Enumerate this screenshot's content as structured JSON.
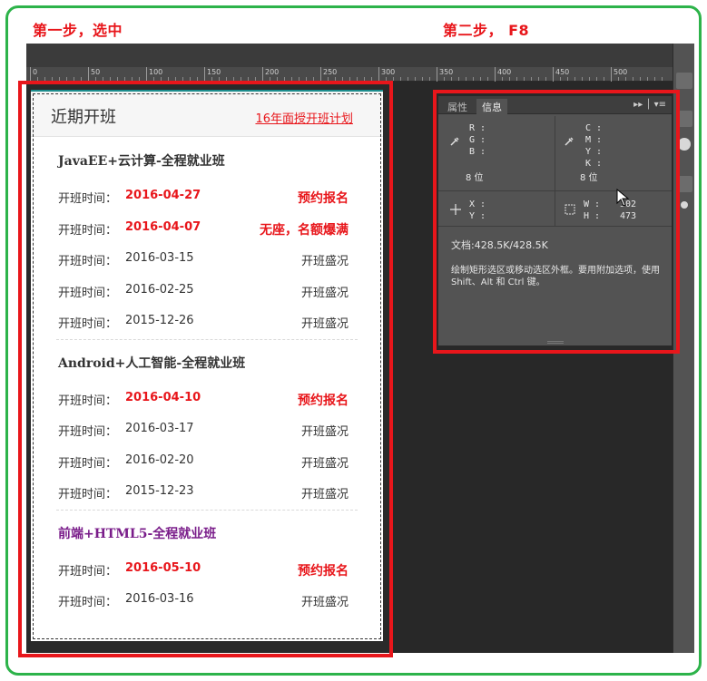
{
  "annotations": {
    "step1": "第一步，选中",
    "step2": "第二步， F8"
  },
  "ruler": {
    "labels": [
      "0",
      "50",
      "100",
      "150",
      "200",
      "250",
      "300",
      "350",
      "400",
      "450",
      "500"
    ]
  },
  "schedule": {
    "title": "近期开班",
    "plan_link": "16年面授开班计划",
    "courses": [
      {
        "name": "JavaEE+云计算-全程就业班",
        "color": "#333333",
        "rows": [
          {
            "label": "开班时间：",
            "date": "2016-04-27",
            "status": "预约报名",
            "highlight": true
          },
          {
            "label": "开班时间：",
            "date": "2016-04-07",
            "status": "无座，名额爆满",
            "highlight": true
          },
          {
            "label": "开班时间：",
            "date": "2016-03-15",
            "status": "开班盛况",
            "highlight": false
          },
          {
            "label": "开班时间：",
            "date": "2016-02-25",
            "status": "开班盛况",
            "highlight": false
          },
          {
            "label": "开班时间：",
            "date": "2015-12-26",
            "status": "开班盛况",
            "highlight": false
          }
        ]
      },
      {
        "name": "Android+人工智能-全程就业班",
        "color": "#333333",
        "rows": [
          {
            "label": "开班时间：",
            "date": "2016-04-10",
            "status": "预约报名",
            "highlight": true
          },
          {
            "label": "开班时间：",
            "date": "2016-03-17",
            "status": "开班盛况",
            "highlight": false
          },
          {
            "label": "开班时间：",
            "date": "2016-02-20",
            "status": "开班盛况",
            "highlight": false
          },
          {
            "label": "开班时间：",
            "date": "2015-12-23",
            "status": "开班盛况",
            "highlight": false
          }
        ]
      },
      {
        "name": "前端+HTML5-全程就业班",
        "color": "#7a1d8a",
        "rows": [
          {
            "label": "开班时间：",
            "date": "2016-05-10",
            "status": "预约报名",
            "highlight": true
          },
          {
            "label": "开班时间：",
            "date": "2016-03-16",
            "status": "开班盛况",
            "highlight": false
          }
        ]
      }
    ]
  },
  "info_panel": {
    "tabs": [
      "属性",
      "信息"
    ],
    "active_tab": "信息",
    "rgb": {
      "r": "R :",
      "g": "G :",
      "b": "B :",
      "bits": "8 位"
    },
    "cmyk": {
      "c": "C :",
      "m": "M :",
      "y": "Y :",
      "k": "K :",
      "bits": "8 位"
    },
    "xy": {
      "x": "X :",
      "y": "Y :"
    },
    "wh": {
      "w": "W :",
      "h": "H :",
      "w_value": "302",
      "h_value": "473"
    },
    "doc_size": "文档:428.5K/428.5K",
    "hint": "绘制矩形选区或移动选区外框。要用附加选项，使用 Shift、Alt 和 Ctrl 键。"
  },
  "colors": {
    "annotation_red": "#e8161b",
    "frame_green": "#2db34a",
    "ps_panel": "#535353",
    "ps_workspace": "#282828"
  }
}
